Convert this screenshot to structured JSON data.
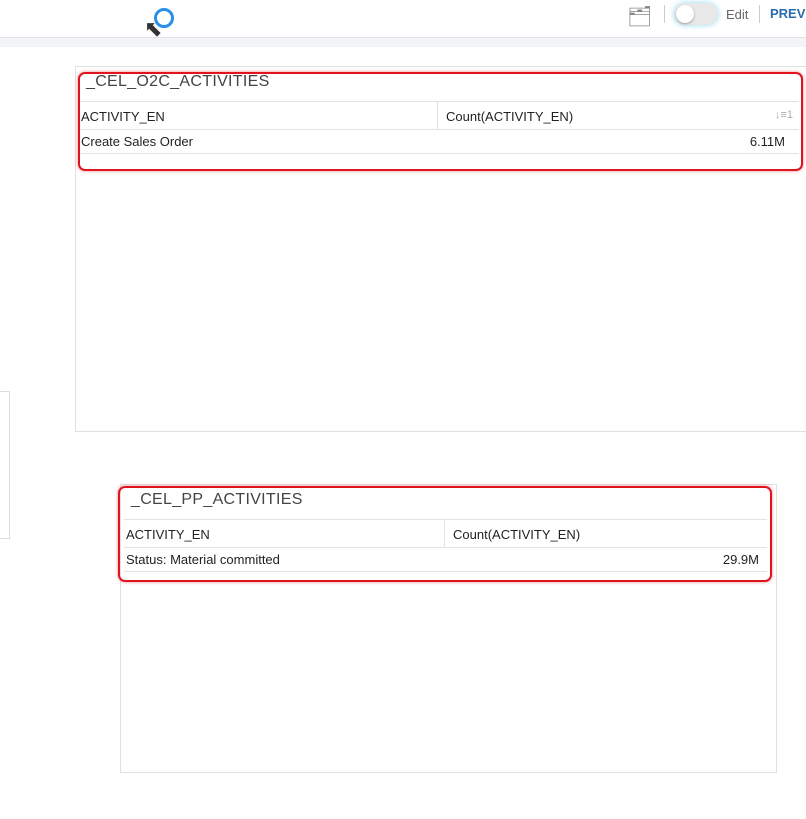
{
  "header": {
    "edit_label": "Edit",
    "preview_label": "PREVI",
    "edit_toggle_on": false
  },
  "tables": [
    {
      "title": "_CEL_O2C_ACTIVITIES",
      "columns": [
        "ACTIVITY_EN",
        "Count(ACTIVITY_EN)"
      ],
      "sort_indicator": "1",
      "rows": [
        {
          "activity": "Create Sales Order",
          "count": "6.11M"
        }
      ]
    },
    {
      "title": "_CEL_PP_ACTIVITIES",
      "columns": [
        "ACTIVITY_EN",
        "Count(ACTIVITY_EN)"
      ],
      "rows": [
        {
          "activity": "Status: Material committed",
          "count": "29.9M"
        }
      ]
    }
  ],
  "colors": {
    "highlight": "#e0141e",
    "accent": "#2b6cb0"
  }
}
